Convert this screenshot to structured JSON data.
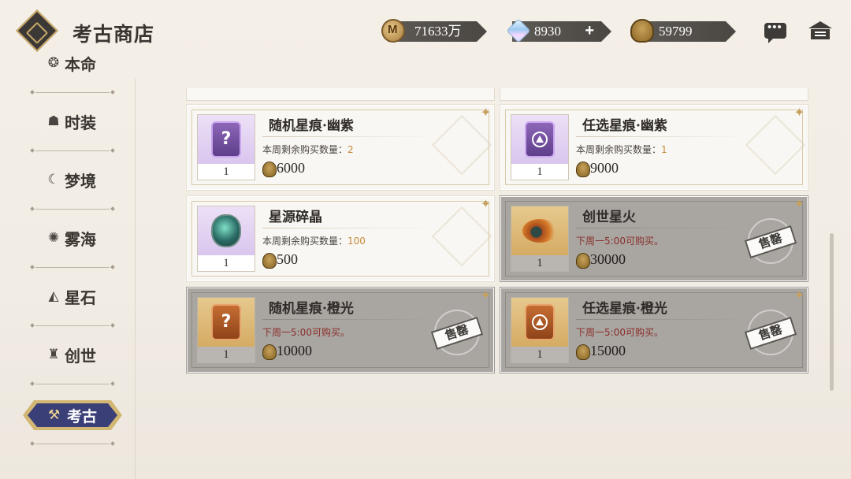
{
  "header": {
    "title": "考古商店",
    "currencies": [
      {
        "name": "coin",
        "icon": "coin-icon",
        "amount": "71633万"
      },
      {
        "name": "crystal",
        "icon": "crystal-icon",
        "amount": "8930",
        "add": "+"
      },
      {
        "name": "shell",
        "icon": "shell-icon",
        "amount": "59799"
      }
    ]
  },
  "sidebar": {
    "items": [
      {
        "label": "本命",
        "icon": "soul-icon"
      },
      {
        "label": "时装",
        "icon": "hat-icon"
      },
      {
        "label": "梦境",
        "icon": "moon-icon"
      },
      {
        "label": "雾海",
        "icon": "mist-icon"
      },
      {
        "label": "星石",
        "icon": "star-stone-icon"
      },
      {
        "label": "创世",
        "icon": "creation-icon"
      },
      {
        "label": "考古",
        "icon": "shovel-icon",
        "active": true
      }
    ]
  },
  "shop": {
    "limit_prefix": "本周剩余购买数量：",
    "soldout_note": "下周一5:00可购买。",
    "soldout_stamp": "售罄",
    "items": [
      {
        "name": "随机星痕·幽紫",
        "qty": "1",
        "limit": "2",
        "price": "6000",
        "soldout": false
      },
      {
        "name": "任选星痕·幽紫",
        "qty": "1",
        "limit": "1",
        "price": "9000",
        "soldout": false
      },
      {
        "name": "星源碎晶",
        "qty": "1",
        "limit": "100",
        "price": "500",
        "soldout": false
      },
      {
        "name": "创世星火",
        "qty": "1",
        "price": "30000",
        "soldout": true
      },
      {
        "name": "随机星痕·橙光",
        "qty": "1",
        "price": "10000",
        "soldout": true
      },
      {
        "name": "任选星痕·橙光",
        "qty": "1",
        "price": "15000",
        "soldout": true
      }
    ]
  },
  "colors": {
    "accent_nav": "#3a3f78",
    "gold": "#d2b774",
    "limit_count": "#c58a3a",
    "soldout_note": "#8a2e2a"
  }
}
